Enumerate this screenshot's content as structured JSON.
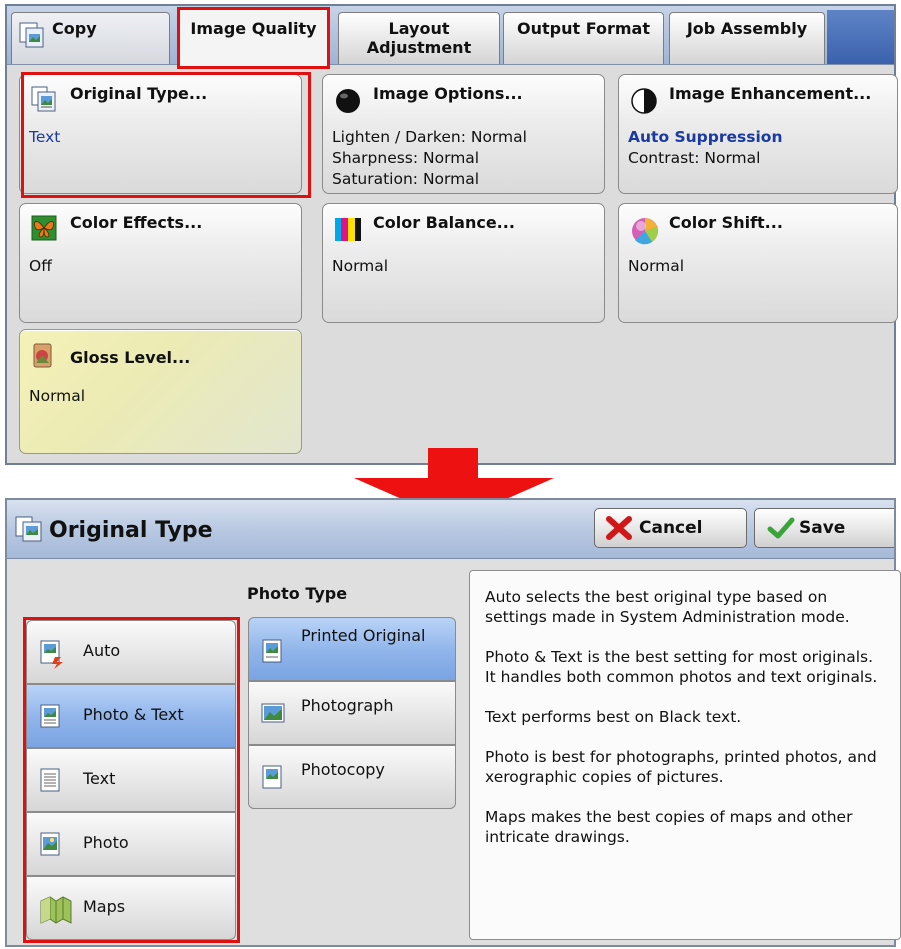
{
  "tabs": [
    {
      "label": "Copy"
    },
    {
      "label": "Image Quality"
    },
    {
      "label": "Layout Adjustment"
    },
    {
      "label": "Output Format"
    },
    {
      "label": "Job Assembly"
    }
  ],
  "tiles": {
    "original_type": {
      "title": "Original Type...",
      "lines": [
        "Text"
      ]
    },
    "image_options": {
      "title": "Image Options...",
      "lines": [
        "Lighten / Darken: Normal",
        "Sharpness: Normal",
        "Saturation: Normal"
      ]
    },
    "image_enhancement": {
      "title": "Image Enhancement...",
      "lines": [
        "Auto Suppression",
        "Contrast: Normal"
      ]
    },
    "color_effects": {
      "title": "Color Effects...",
      "lines": [
        "Off"
      ]
    },
    "color_balance": {
      "title": "Color Balance...",
      "lines": [
        "Normal"
      ]
    },
    "color_shift": {
      "title": "Color Shift...",
      "lines": [
        "Normal"
      ]
    },
    "gloss_level": {
      "title": "Gloss Level...",
      "lines": [
        "Normal"
      ]
    }
  },
  "dialog": {
    "title": "Original Type",
    "cancel_label": "Cancel",
    "save_label": "Save",
    "photo_type_label": "Photo Type",
    "types": [
      {
        "label": "Auto"
      },
      {
        "label": "Photo & Text"
      },
      {
        "label": "Text"
      },
      {
        "label": "Photo"
      },
      {
        "label": "Maps"
      }
    ],
    "photo_types": [
      {
        "label": "Printed Original"
      },
      {
        "label": "Photograph"
      },
      {
        "label": "Photocopy"
      }
    ],
    "selected_type": "Photo & Text",
    "selected_photo_type": "Printed Original",
    "info": [
      "Auto selects the best original type based on settings made in System Administration mode.",
      "Photo & Text is the best setting for most originals. It handles both common photos and text originals.",
      "Text performs best on Black text.",
      "Photo is best for photographs, printed photos, and xerographic copies of pictures.",
      "Maps makes the best copies of maps and other intricate drawings."
    ]
  },
  "colors": {
    "highlight": "#e01010",
    "selected": "#8fb4ea",
    "accent_blue": "#1a3aa0"
  }
}
